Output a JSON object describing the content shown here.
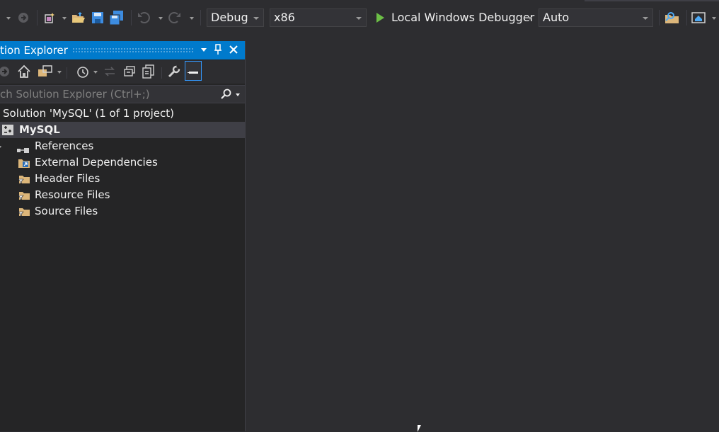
{
  "toolbar": {
    "config_combo": "Debug",
    "platform_combo": "x86",
    "run_label": "Local Windows Debugger",
    "auto_combo": "Auto"
  },
  "solution_explorer": {
    "title": "tion Explorer",
    "search_placeholder": "ch Solution Explorer (Ctrl+;)",
    "solution_label": "Solution 'MySQL' (1 of 1 project)",
    "project_label": "MySQL",
    "items": [
      {
        "label": "References",
        "icon": "references-icon"
      },
      {
        "label": "External Dependencies",
        "icon": "external-deps-folder-icon"
      },
      {
        "label": "Header Files",
        "icon": "filter-folder-icon"
      },
      {
        "label": "Resource Files",
        "icon": "filter-folder-icon"
      },
      {
        "label": "Source Files",
        "icon": "filter-folder-icon"
      }
    ]
  },
  "colors": {
    "accent": "#007acc",
    "background": "#2d2d30",
    "panel": "#252526",
    "folder": "#dcb67a",
    "run_green": "#6cbf46"
  }
}
